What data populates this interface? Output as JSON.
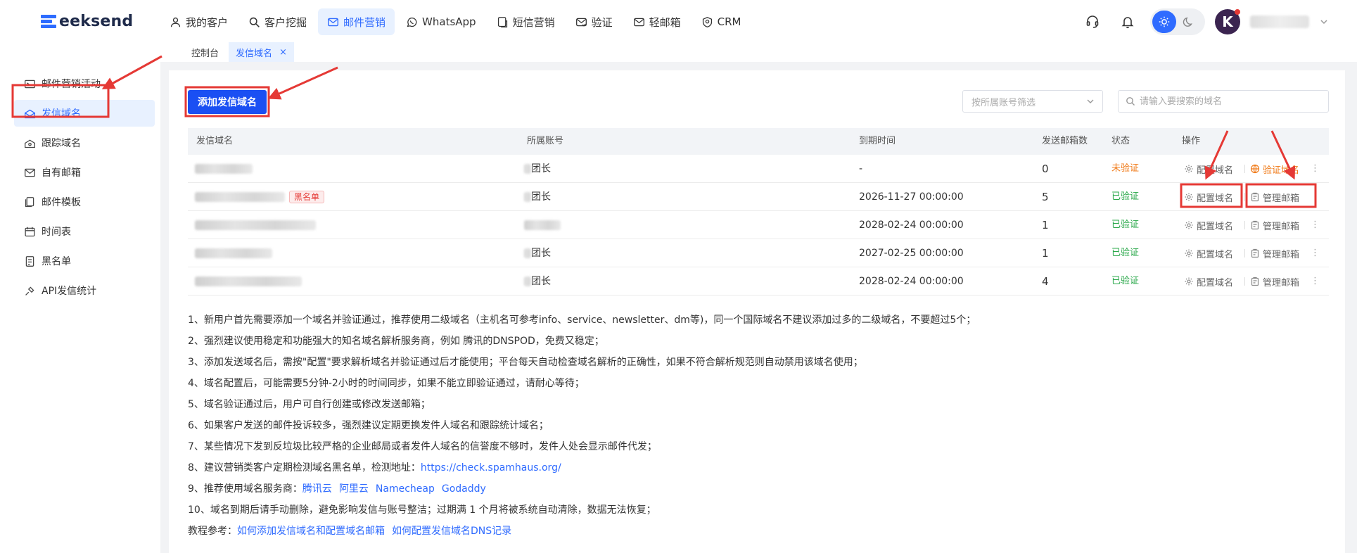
{
  "brand": {
    "logo_text": "eeksend",
    "logo_letter": "G"
  },
  "nav": [
    {
      "label": "我的客户",
      "icon": "user-icon"
    },
    {
      "label": "客户挖掘",
      "icon": "search-icon"
    },
    {
      "label": "邮件营销",
      "icon": "mail-icon",
      "active": true
    },
    {
      "label": "WhatsApp",
      "icon": "whatsapp-icon"
    },
    {
      "label": "短信营销",
      "icon": "sms-icon"
    },
    {
      "label": "验证",
      "icon": "verify-icon"
    },
    {
      "label": "轻邮箱",
      "icon": "light-mail-icon"
    },
    {
      "label": "CRM",
      "icon": "crm-icon"
    }
  ],
  "header": {
    "avatar_letter": "K"
  },
  "tabs": [
    {
      "label": "控制台"
    },
    {
      "label": "发信域名",
      "close": "×",
      "active": true
    }
  ],
  "sidebar": [
    {
      "label": "邮件营销活动",
      "icon": "campaign-icon"
    },
    {
      "label": "发信域名",
      "icon": "domain-icon",
      "active": true
    },
    {
      "label": "跟踪域名",
      "icon": "track-icon"
    },
    {
      "label": "自有邮箱",
      "icon": "mailbox-icon"
    },
    {
      "label": "邮件模板",
      "icon": "template-icon"
    },
    {
      "label": "时间表",
      "icon": "calendar-icon"
    },
    {
      "label": "黑名单",
      "icon": "blacklist-icon"
    },
    {
      "label": "API发信统计",
      "icon": "api-icon"
    }
  ],
  "toolbar": {
    "add_label": "添加发信域名",
    "account_filter_placeholder": "按所属账号筛选",
    "search_placeholder": "请输入要搜索的域名"
  },
  "table": {
    "columns": [
      "发信域名",
      "所属账号",
      "到期时间",
      "发送邮箱数",
      "状态",
      "操作"
    ],
    "rows": [
      {
        "account": "团长",
        "expiry": "-",
        "count": "0",
        "status": "未验证",
        "status_type": "unverified",
        "blacklist": false,
        "op1": "配置域名",
        "op2": "验证域名"
      },
      {
        "account": "团长",
        "expiry": "2026-11-27 00:00:00",
        "count": "5",
        "status": "已验证",
        "status_type": "verified",
        "blacklist": true,
        "blacklist_label": "黑名单",
        "op1": "配置域名",
        "op2": "管理邮箱"
      },
      {
        "account": "",
        "expiry": "2028-02-24 00:00:00",
        "count": "1",
        "status": "已验证",
        "status_type": "verified",
        "blacklist": false,
        "op1": "配置域名",
        "op2": "管理邮箱"
      },
      {
        "account": "团长",
        "expiry": "2027-02-25 00:00:00",
        "count": "1",
        "status": "已验证",
        "status_type": "verified",
        "blacklist": false,
        "op1": "配置域名",
        "op2": "管理邮箱"
      },
      {
        "account": "团长",
        "expiry": "2028-02-24 00:00:00",
        "count": "4",
        "status": "已验证",
        "status_type": "verified",
        "blacklist": false,
        "op1": "配置域名",
        "op2": "管理邮箱"
      }
    ],
    "more": "⋮"
  },
  "notes": {
    "n1": "1、新用户首先需要添加一个域名并验证通过，推荐使用二级域名（主机名可参考info、service、newsletter、dm等)，同一个国际域名不建议添加过多的二级域名，不要超过5个；",
    "n2": "2、强烈建议使用稳定和功能强大的知名域名解析服务商，例如 腾讯的DNSPOD，免费又稳定；",
    "n3": "3、添加发送域名后，需按\"配置\"要求解析域名并验证通过后才能使用；平台每天自动检查域名解析的正确性，如果不符合解析规范则自动禁用该域名使用；",
    "n4": "4、域名配置后，可能需要5分钟-2小时的时间同步，如果不能立即验证通过，请耐心等待；",
    "n5": "5、域名验证通过后，用户可自行创建或修改发送邮箱；",
    "n6": "6、如果客户发送的邮件投诉较多，强烈建议定期更换发件人域名和跟踪统计域名；",
    "n7": "7、某些情况下发到反垃圾比较严格的企业邮局或者发件人域名的信誉度不够时，发件人处会显示邮件代发；",
    "n8_prefix": "8、建议营销类客户定期检测域名黑名单，检测地址：",
    "n8_link": "https://check.spamhaus.org/",
    "n9_prefix": "9、推荐使用域名服务商：",
    "n9_links": [
      "腾讯云",
      "阿里云",
      "Namecheap",
      "Godaddy"
    ],
    "n10": "10、域名到期后请手动删除，避免影响发信与账号整洁；过期满 1 个月将被系统自动清除，数据无法恢复；",
    "tut_prefix": "教程参考：",
    "tut_links": [
      "如何添加发信域名和配置域名邮箱",
      "如何配置发信域名DNS记录"
    ]
  },
  "colors": {
    "accent": "#2f6bff",
    "primary_button": "#1a4ff3",
    "annotation": "#e53935",
    "verified": "#2aa84a",
    "unverified": "#f07a18"
  }
}
